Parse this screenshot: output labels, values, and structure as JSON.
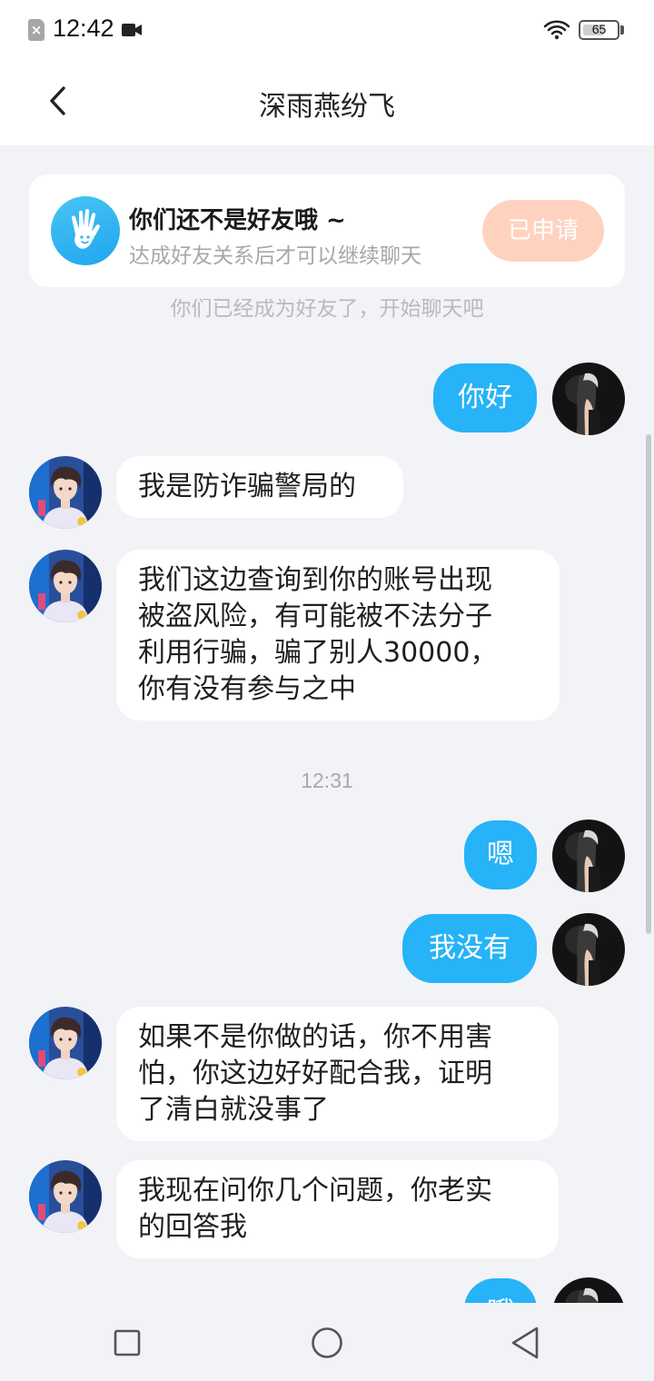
{
  "status_bar": {
    "time": "12:42",
    "battery": "65",
    "battery_fraction": 0.65,
    "sim_glyph": "×"
  },
  "header": {
    "title": "深雨燕纷飞",
    "back_icon": "chevron-left-icon"
  },
  "friend_notice": {
    "title": "你们还不是好友哦 ~",
    "subtitle": "达成好友关系后才可以继续聊天",
    "button": "已申请",
    "icon": "waving-hand-icon",
    "peek_text": "你们已经成为好友了，开始聊天吧"
  },
  "messages": [
    {
      "side": "out",
      "text": "你好"
    },
    {
      "side": "in",
      "text": "我是防诈骗警局的"
    },
    {
      "side": "in",
      "lines": [
        "我们这边查询到你的账号出现",
        "被盗风险，有可能被不法分子",
        "利用行骗，骗了别人30000，",
        "你有没有参与之中"
      ]
    },
    {
      "side": "out",
      "text": "嗯"
    },
    {
      "side": "out",
      "text": "我没有"
    },
    {
      "side": "in",
      "lines": [
        "如果不是你做的话，你不用害",
        "怕，你这边好好配合我，证明",
        "了清白就没事了"
      ]
    },
    {
      "side": "in",
      "lines": [
        "我现在问你几个问题，你老实",
        "的回答我"
      ]
    },
    {
      "side": "out",
      "text": "哦"
    }
  ],
  "timestamp": "12:31",
  "nav": {
    "recent": "square-icon",
    "home": "circle-icon",
    "back": "triangle-back-icon"
  },
  "colors": {
    "outgoing_bubble": "#26b3f7",
    "incoming_bubble": "#ffffff",
    "background": "#f2f3f7",
    "applied_button": "#ffd2c0"
  }
}
